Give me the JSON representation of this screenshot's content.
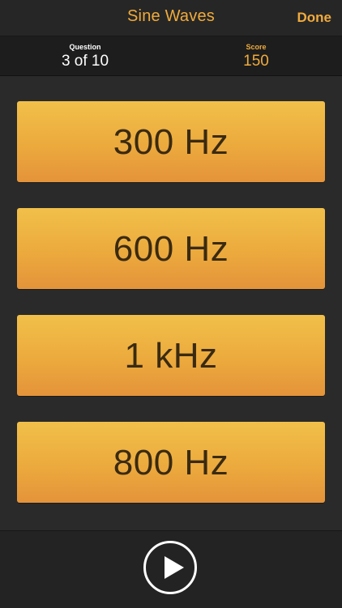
{
  "nav": {
    "title": "Sine Waves",
    "done_label": "Done"
  },
  "stats": {
    "question_label": "Question",
    "question_value": "3 of 10",
    "score_label": "Score",
    "score_value": "150"
  },
  "answers": [
    {
      "label": "300 Hz"
    },
    {
      "label": "600 Hz"
    },
    {
      "label": "1 kHz"
    },
    {
      "label": "800 Hz"
    }
  ],
  "controls": {
    "play_icon": "play-icon"
  },
  "colors": {
    "accent": "#f0ab3c",
    "button_top": "#f1c04a",
    "button_bottom": "#e4933a",
    "background": "#2a2a2a"
  }
}
